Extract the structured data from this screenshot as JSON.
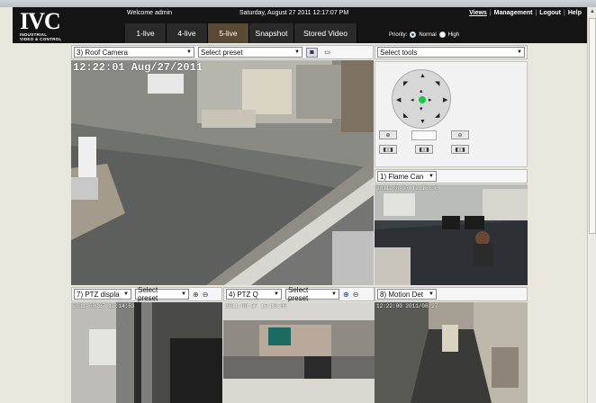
{
  "header": {
    "welcome": "Welcome admin",
    "datetime": "Saturday, August 27 2011 12:17:07 PM",
    "links": [
      "Views",
      "Management",
      "Logout",
      "Help"
    ],
    "logo_big": "IVC",
    "logo_small_1": "INDUSTRIAL",
    "logo_small_2": "VIDEO & CONTROL",
    "tabs": [
      "1-live",
      "4-live",
      "5-live",
      "Snapshot",
      "Stored Video"
    ],
    "active_tab": "5-live",
    "priority_label": "Priority:",
    "priority_options": [
      "Normal",
      "High"
    ],
    "priority_selected": "Normal"
  },
  "main_camera": {
    "camera_select": "3) Roof Camera",
    "preset_select": "Select preset",
    "timestamp": "12:22:01 Aug/27/2011"
  },
  "tools": {
    "select_label": "Select tools"
  },
  "cameras": [
    {
      "select": "1) Flame Can",
      "timestamp": "2011-08-27 12:16:06"
    },
    {
      "select": "7) PTZ displa",
      "preset": "Select preset",
      "timestamp": "2011-08-27 12:14:53"
    },
    {
      "select": "4) PTZ Q",
      "preset": "Select preset",
      "timestamp": "2011-08-27 12:16:06"
    },
    {
      "select": "8) Motion Det",
      "timestamp": "12:22:00 2011/08/27"
    }
  ],
  "icons": {
    "zoom_in": "zoom-in-icon",
    "zoom_out": "zoom-out-icon",
    "snapshot": "camera-icon",
    "record": "film-icon"
  },
  "colors": {
    "topbar": "#141414",
    "active_tab": "#5a4a34",
    "page_bg": "#e9e6dc",
    "ptz_center": "#2bbf3a"
  }
}
